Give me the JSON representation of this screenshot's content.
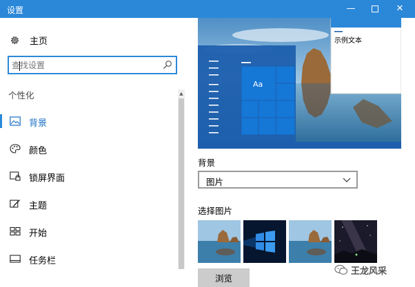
{
  "window": {
    "title": "设置",
    "minimize_glyph": "—",
    "close_glyph": "✕"
  },
  "sidebar": {
    "home_label": "主页",
    "search_placeholder": "查找设置",
    "section_title": "个性化",
    "items": [
      {
        "label": "背景",
        "icon": "image-icon",
        "active": true
      },
      {
        "label": "颜色",
        "icon": "palette-icon",
        "active": false
      },
      {
        "label": "锁屏界面",
        "icon": "lock-screen-icon",
        "active": false
      },
      {
        "label": "主题",
        "icon": "theme-brush-icon",
        "active": false
      },
      {
        "label": "开始",
        "icon": "start-tiles-icon",
        "active": false
      },
      {
        "label": "任务栏",
        "icon": "taskbar-icon",
        "active": false
      }
    ]
  },
  "main": {
    "preview": {
      "sample_text": "示例文本",
      "tile_text": "Aa"
    },
    "background_label": "背景",
    "background_value": "图片",
    "choose_picture_label": "选择图片",
    "thumbnails": [
      "beach-rock",
      "windows-hero",
      "beach-rock",
      "night-sky"
    ],
    "browse_label": "浏览"
  },
  "watermark": {
    "label": "王龙风采"
  },
  "colors": {
    "accent": "#2b88d8",
    "active_text": "#1a6fc4",
    "start_menu": "#1d5fae"
  }
}
